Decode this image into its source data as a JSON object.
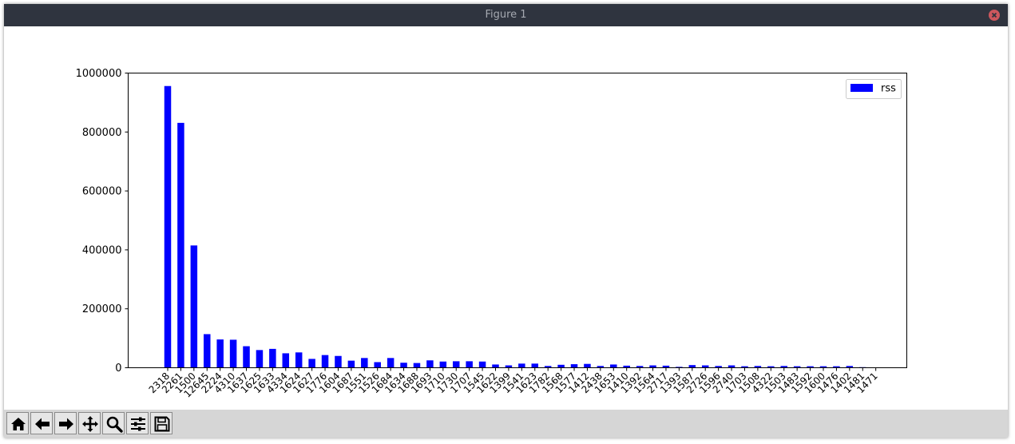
{
  "window": {
    "title": "Figure 1"
  },
  "toolbar": {
    "buttons": [
      {
        "name": "home-icon"
      },
      {
        "name": "back-arrow-icon"
      },
      {
        "name": "forward-arrow-icon"
      },
      {
        "name": "pan-icon"
      },
      {
        "name": "zoom-icon"
      },
      {
        "name": "configure-subplots-icon"
      },
      {
        "name": "save-icon"
      }
    ]
  },
  "colors": {
    "bar": "#0000ff",
    "titlebar": "#2f343f",
    "toolbar": "#d6d6d6",
    "close": "#cc575d"
  },
  "chart_data": {
    "type": "bar",
    "categories": [
      "2318",
      "2261",
      "1500",
      "12645",
      "2224",
      "4310",
      "1637",
      "1625",
      "1633",
      "4334",
      "1624",
      "1627",
      "1776",
      "1604",
      "1687",
      "1551",
      "1526",
      "1684",
      "1634",
      "1688",
      "1693",
      "1710",
      "1730",
      "1707",
      "1545",
      "1622",
      "1399",
      "1541",
      "1623",
      "1782",
      "1568",
      "1577",
      "1412",
      "2438",
      "1653",
      "1410",
      "1392",
      "1564",
      "2717",
      "1393",
      "1587",
      "2726",
      "1596",
      "2740",
      "1703",
      "1508",
      "4322",
      "1503",
      "1483",
      "1592",
      "1600",
      "1476",
      "1402",
      "1481",
      "1471"
    ],
    "series": [
      {
        "name": "rss",
        "values": [
          956000,
          831000,
          415000,
          114000,
          96000,
          95000,
          73000,
          60000,
          64000,
          49000,
          52000,
          30000,
          43000,
          40000,
          24000,
          33000,
          19000,
          33000,
          17000,
          16000,
          25000,
          21000,
          22000,
          22000,
          21000,
          11000,
          8000,
          14000,
          14000,
          6000,
          10000,
          12000,
          13000,
          6000,
          11000,
          7000,
          6000,
          8000,
          7000,
          3000,
          9000,
          8000,
          6000,
          8000,
          5000,
          6000,
          5000,
          6000,
          5000,
          5000,
          5000,
          5000,
          6000,
          2000,
          0
        ]
      }
    ],
    "yticks": [
      "0",
      "200000",
      "400000",
      "600000",
      "800000",
      "1000000"
    ],
    "ylim": [
      0,
      1000000
    ],
    "legend_position": "top-right",
    "grid": false
  }
}
